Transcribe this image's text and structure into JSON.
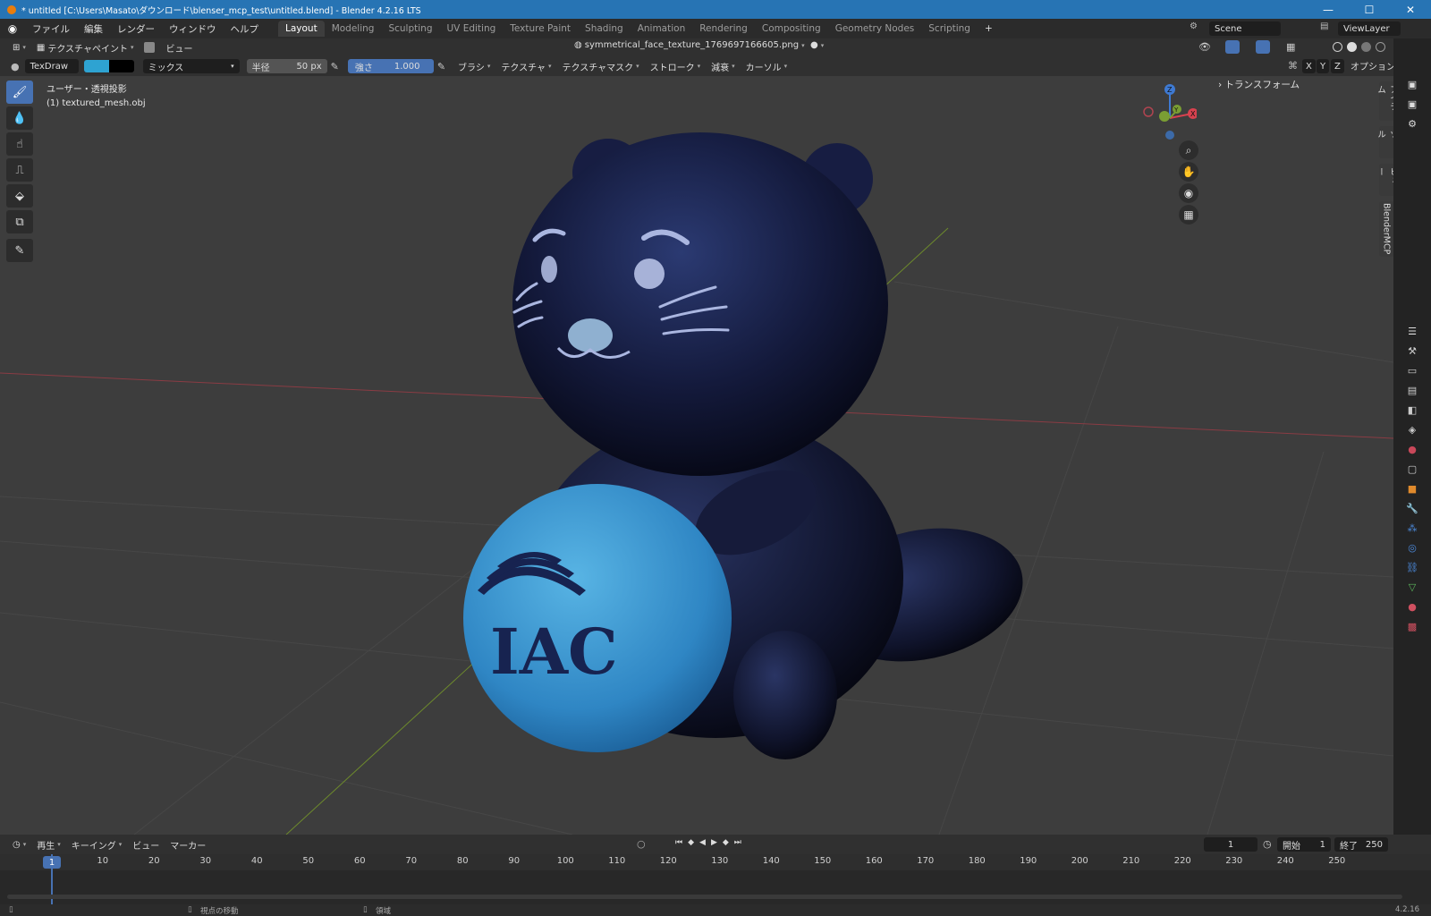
{
  "window": {
    "title": "* untitled [C:\\Users\\Masato\\ダウンロード\\blenser_mcp_test\\untitled.blend] - Blender 4.2.16 LTS",
    "minimize": "—",
    "maximize": "☐",
    "close": "✕"
  },
  "menu": [
    "ファイル",
    "編集",
    "レンダー",
    "ウィンドウ",
    "ヘルプ"
  ],
  "workspaces": [
    "Layout",
    "Modeling",
    "Sculpting",
    "UV Editing",
    "Texture Paint",
    "Shading",
    "Animation",
    "Rendering",
    "Compositing",
    "Geometry Nodes",
    "Scripting"
  ],
  "workspace_add": "+",
  "scene": {
    "name": "Scene",
    "view_layer": "ViewLayer"
  },
  "header": {
    "mode": "テクスチャペイント",
    "view_menu": "ビュー",
    "image_name": "symmetrical_face_texture_1769697166605.png"
  },
  "tool_settings": {
    "brush_name": "TexDraw",
    "blend": "ミックス",
    "radius_label": "半径",
    "radius_value": "50 px",
    "strength_label": "強さ",
    "strength_value": "1.000",
    "strength_fraction": 1.0,
    "menus": [
      "ブラシ",
      "テクスチャ",
      "テクスチャマスク",
      "ストローク",
      "減衰",
      "カーソル"
    ],
    "axis": [
      "X",
      "Y",
      "Z"
    ],
    "options": "オプション",
    "colors": {
      "primary": "#2ea3d2",
      "secondary": "#000000"
    }
  },
  "viewport": {
    "view_label": "ユーザー・透視投影",
    "object_label": "(1) textured_mesh.obj",
    "gizmo": {
      "z": "Z",
      "y": "Y",
      "x": "X"
    },
    "ball_text": "IAC"
  },
  "sidebar": {
    "panel_title": "トランスフォーム",
    "tabs": [
      "アイテム",
      "ツール",
      "ビュー",
      "BlenderMCP"
    ]
  },
  "timeline": {
    "menus": [
      "再生",
      "キーイング",
      "ビュー",
      "マーカー"
    ],
    "current_frame": "1",
    "start_label": "開始",
    "start_value": "1",
    "end_label": "終了",
    "end_value": "250",
    "ticks": [
      "1",
      "10",
      "20",
      "30",
      "40",
      "50",
      "60",
      "70",
      "80",
      "90",
      "100",
      "110",
      "120",
      "130",
      "140",
      "150",
      "160",
      "170",
      "180",
      "190",
      "200",
      "210",
      "220",
      "230",
      "240",
      "250"
    ]
  },
  "status": {
    "left": "視点の移動",
    "middle": "領域",
    "version": "4.2.16"
  },
  "colors": {
    "accent": "#4772b3",
    "titlebar": "#2774b4",
    "viewport": "#3d3d3d"
  }
}
